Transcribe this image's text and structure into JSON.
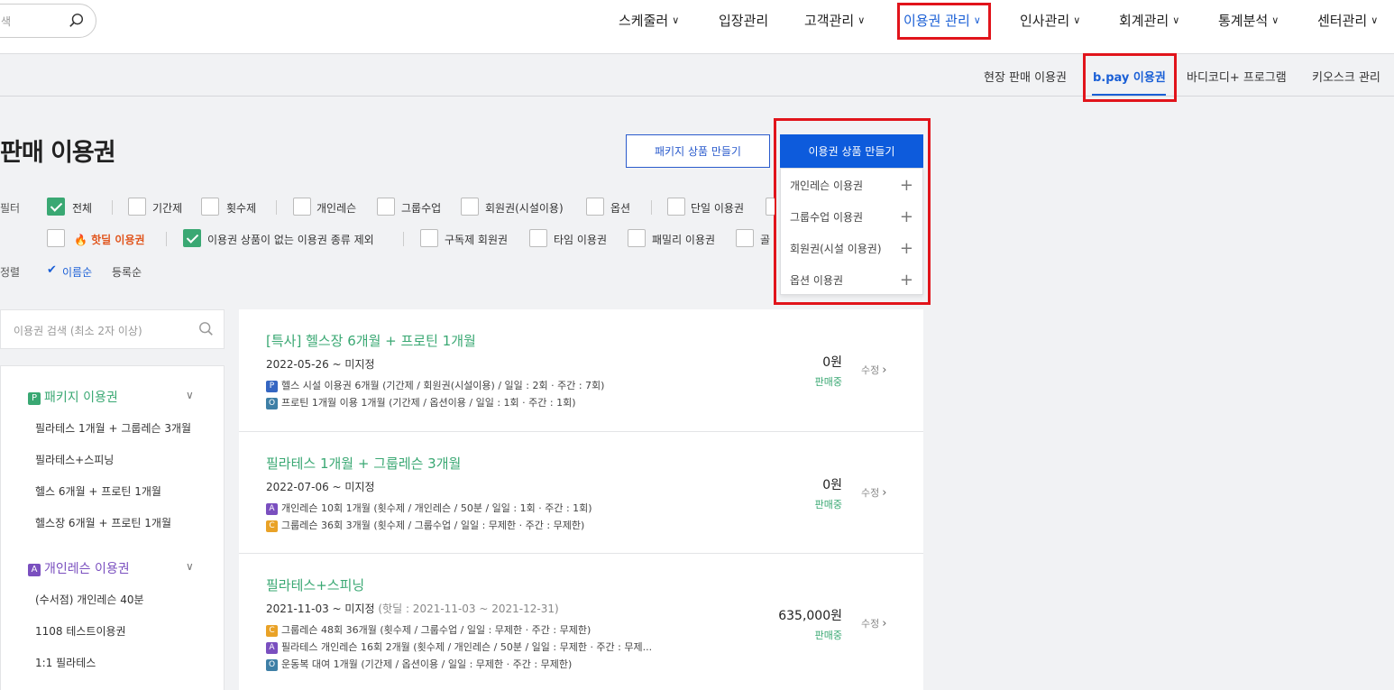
{
  "top_nav": {
    "search_placeholder": "색",
    "items": [
      {
        "label": "스케줄러",
        "chevron": true
      },
      {
        "label": "입장관리",
        "chevron": false
      },
      {
        "label": "고객관리",
        "chevron": true
      },
      {
        "label": "이용권 관리",
        "chevron": true,
        "active": true
      },
      {
        "label": "인사관리",
        "chevron": true
      },
      {
        "label": "회계관리",
        "chevron": true
      },
      {
        "label": "통계분석",
        "chevron": true
      },
      {
        "label": "센터관리",
        "chevron": true
      }
    ]
  },
  "sub_nav": {
    "items": [
      "현장 판매 이용권",
      "b.pay 이용권",
      "바디코디+ 프로그램",
      "키오스크 관리"
    ],
    "active": "b.pay 이용권"
  },
  "page": {
    "title": "판매 이용권",
    "package_button": "패키지 상품 만들기",
    "create_button": "이용권 상품 만들기",
    "create_menu": [
      "개인레슨 이용권",
      "그룹수업 이용권",
      "회원권(시설 이용권)",
      "옵션 이용권"
    ]
  },
  "filters": {
    "label": "필터",
    "row1": [
      {
        "label": "전체",
        "checked": true
      },
      {
        "label": "기간제",
        "checked": false
      },
      {
        "label": "횟수제",
        "checked": false
      },
      {
        "label": "개인레슨",
        "checked": false
      },
      {
        "label": "그룹수업",
        "checked": false
      },
      {
        "label": "회원권(시설이용)",
        "checked": false
      },
      {
        "label": "옵션",
        "checked": false
      },
      {
        "label": "단일 이용권",
        "checked": false
      }
    ],
    "row2": [
      {
        "label": "핫딜 이용권",
        "checked": false,
        "hot": true
      },
      {
        "label": "이용권 상품이 없는 이용권 종류 제외",
        "checked": true
      },
      {
        "label": "구독제 회원권",
        "checked": false
      },
      {
        "label": "타임 이용권",
        "checked": false
      },
      {
        "label": "패밀리 이용권",
        "checked": false
      },
      {
        "label": "골",
        "checked": false
      }
    ]
  },
  "sort": {
    "label": "정렬",
    "active": "이름순",
    "other": "등록순"
  },
  "left_panel": {
    "search_placeholder": "이용권 검색 (최소 2자 이상)",
    "groups": [
      {
        "badge": "P",
        "title": "패키지 이용권",
        "items": [
          "필라테스 1개월 + 그룹레슨 3개월",
          "필라테스+스피닝",
          "헬스 6개월 + 프로틴 1개월",
          "헬스장 6개월 + 프로틴 1개월"
        ]
      },
      {
        "badge": "A",
        "title": "개인레슨 이용권",
        "items": [
          "(수서점) 개인레슨 40분",
          "1108 테스트이용권",
          "1:1 필라테스"
        ]
      }
    ]
  },
  "cards": [
    {
      "title": "[특사] 헬스장 6개월 + 프로틴 1개월",
      "date": "2022-05-26 ~ 미지정",
      "hotdeal": "",
      "lines": [
        {
          "badge": "P",
          "text": "헬스 시설 이용권 6개월 (기간제 / 회원권(시설이용) / 일일 : 2회 · 주간 : 7회)"
        },
        {
          "badge": "O",
          "text": "프로틴 1개월 이용 1개월 (기간제 / 옵션이용 / 일일 : 1회 · 주간 : 1회)"
        }
      ],
      "price": "0원",
      "status": "판매중",
      "edit": "수정"
    },
    {
      "title": "필라테스 1개월 + 그룹레슨 3개월",
      "date": "2022-07-06 ~ 미지정",
      "hotdeal": "",
      "lines": [
        {
          "badge": "A",
          "text": "개인레슨 10회 1개월 (횟수제 / 개인레슨 / 50분 / 일일 : 1회 · 주간 : 1회)"
        },
        {
          "badge": "C",
          "text": "그룹레슨 36회 3개월 (횟수제 / 그룹수업 / 일일 : 무제한 · 주간 : 무제한)"
        }
      ],
      "price": "0원",
      "status": "판매중",
      "edit": "수정"
    },
    {
      "title": "필라테스+스피닝",
      "date": "2021-11-03 ~ 미지정",
      "hotdeal": "(핫딜 : 2021-11-03 ~ 2021-12-31)",
      "lines": [
        {
          "badge": "C",
          "text": "그룹레슨 48회 36개월 (횟수제 / 그룹수업 / 일일 : 무제한 · 주간 : 무제한)"
        },
        {
          "badge": "A",
          "text": "필라테스 개인레슨 16회 2개월 (횟수제 / 개인레슨 / 50분 / 일일 : 무제한 · 주간 : 무제..."
        },
        {
          "badge": "O",
          "text": "운동복 대여 1개월 (기간제 / 옵션이용 / 일일 : 무제한 · 주간 : 무제한)"
        }
      ],
      "price": "635,000원",
      "status": "판매중",
      "edit": "수정"
    }
  ],
  "colors": {
    "accent": "#0d5bdc",
    "green": "#3aa873",
    "highlight": "#e1141b"
  }
}
